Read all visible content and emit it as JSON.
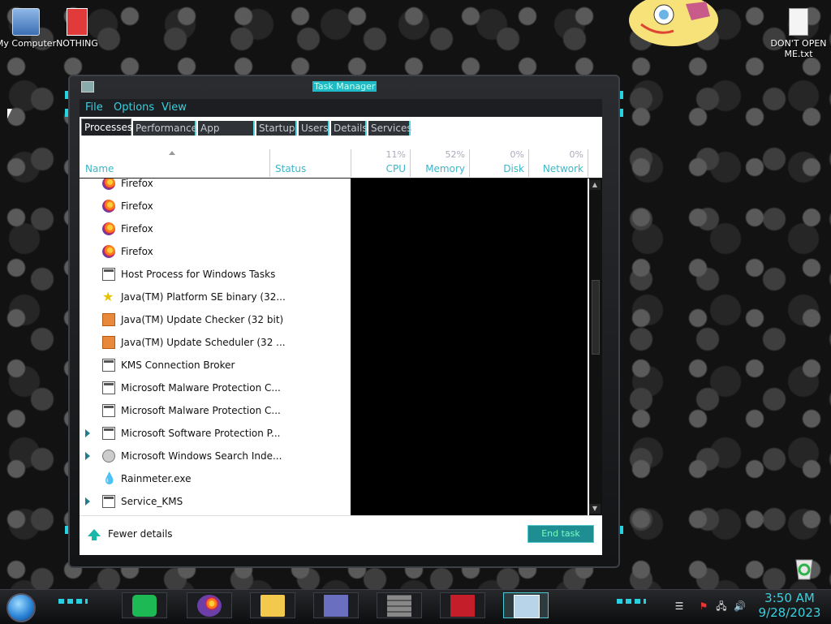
{
  "desktop": {
    "icons": [
      {
        "label": "My Computer",
        "icon": "computer-icon"
      },
      {
        "label": "NOTHING",
        "icon": "document-red-icon"
      },
      {
        "label": "DON'T OPEN ME.txt",
        "icon": "text-file-icon"
      }
    ]
  },
  "window": {
    "title": "Task Manager",
    "menu": [
      "File",
      "Options",
      "View"
    ],
    "tabs": [
      "Processes",
      "Performance",
      "App history",
      "Startup",
      "Users",
      "Details",
      "Services"
    ],
    "active_tab": "Processes",
    "columns": {
      "name": "Name",
      "status": "Status",
      "cpu_pct": "11%",
      "cpu": "CPU",
      "memory_pct": "52%",
      "memory": "Memory",
      "disk_pct": "0%",
      "disk": "Disk",
      "network_pct": "0%",
      "network": "Network"
    },
    "rows": [
      {
        "label": "Firefox",
        "icon": "firefox-icon",
        "expandable": false
      },
      {
        "label": "Firefox",
        "icon": "firefox-icon",
        "expandable": false
      },
      {
        "label": "Firefox",
        "icon": "firefox-icon",
        "expandable": false
      },
      {
        "label": "Firefox",
        "icon": "firefox-icon",
        "expandable": false
      },
      {
        "label": "Host Process for Windows Tasks",
        "icon": "window-icon",
        "expandable": false
      },
      {
        "label": "Java(TM) Platform SE binary (32...",
        "icon": "java-star-icon",
        "expandable": false
      },
      {
        "label": "Java(TM) Update Checker (32 bit)",
        "icon": "java-icon",
        "expandable": false
      },
      {
        "label": "Java(TM) Update Scheduler (32 ...",
        "icon": "java-icon",
        "expandable": false
      },
      {
        "label": "KMS Connection Broker",
        "icon": "window-icon",
        "expandable": false
      },
      {
        "label": "Microsoft Malware Protection C...",
        "icon": "window-icon",
        "expandable": false
      },
      {
        "label": "Microsoft Malware Protection C...",
        "icon": "window-icon",
        "expandable": false
      },
      {
        "label": "Microsoft Software Protection P...",
        "icon": "window-icon",
        "expandable": true
      },
      {
        "label": "Microsoft Windows Search Inde...",
        "icon": "user-icon",
        "expandable": true
      },
      {
        "label": "Rainmeter.exe",
        "icon": "droplet-icon",
        "expandable": false
      },
      {
        "label": "Service_KMS",
        "icon": "window-icon",
        "expandable": true
      }
    ],
    "fewer_details": "Fewer details",
    "end_task": "End task"
  },
  "taskbar": {
    "apps": [
      "spotify-icon",
      "firefox-icon",
      "file-explorer-icon",
      "control-panel-icon",
      "firewall-icon",
      "sticker-app-icon",
      "task-manager-icon"
    ],
    "time": "3:50 AM",
    "date": "9/28/2023"
  },
  "colors": {
    "accent": "#3ad0de",
    "frame": "#1c1e21"
  }
}
